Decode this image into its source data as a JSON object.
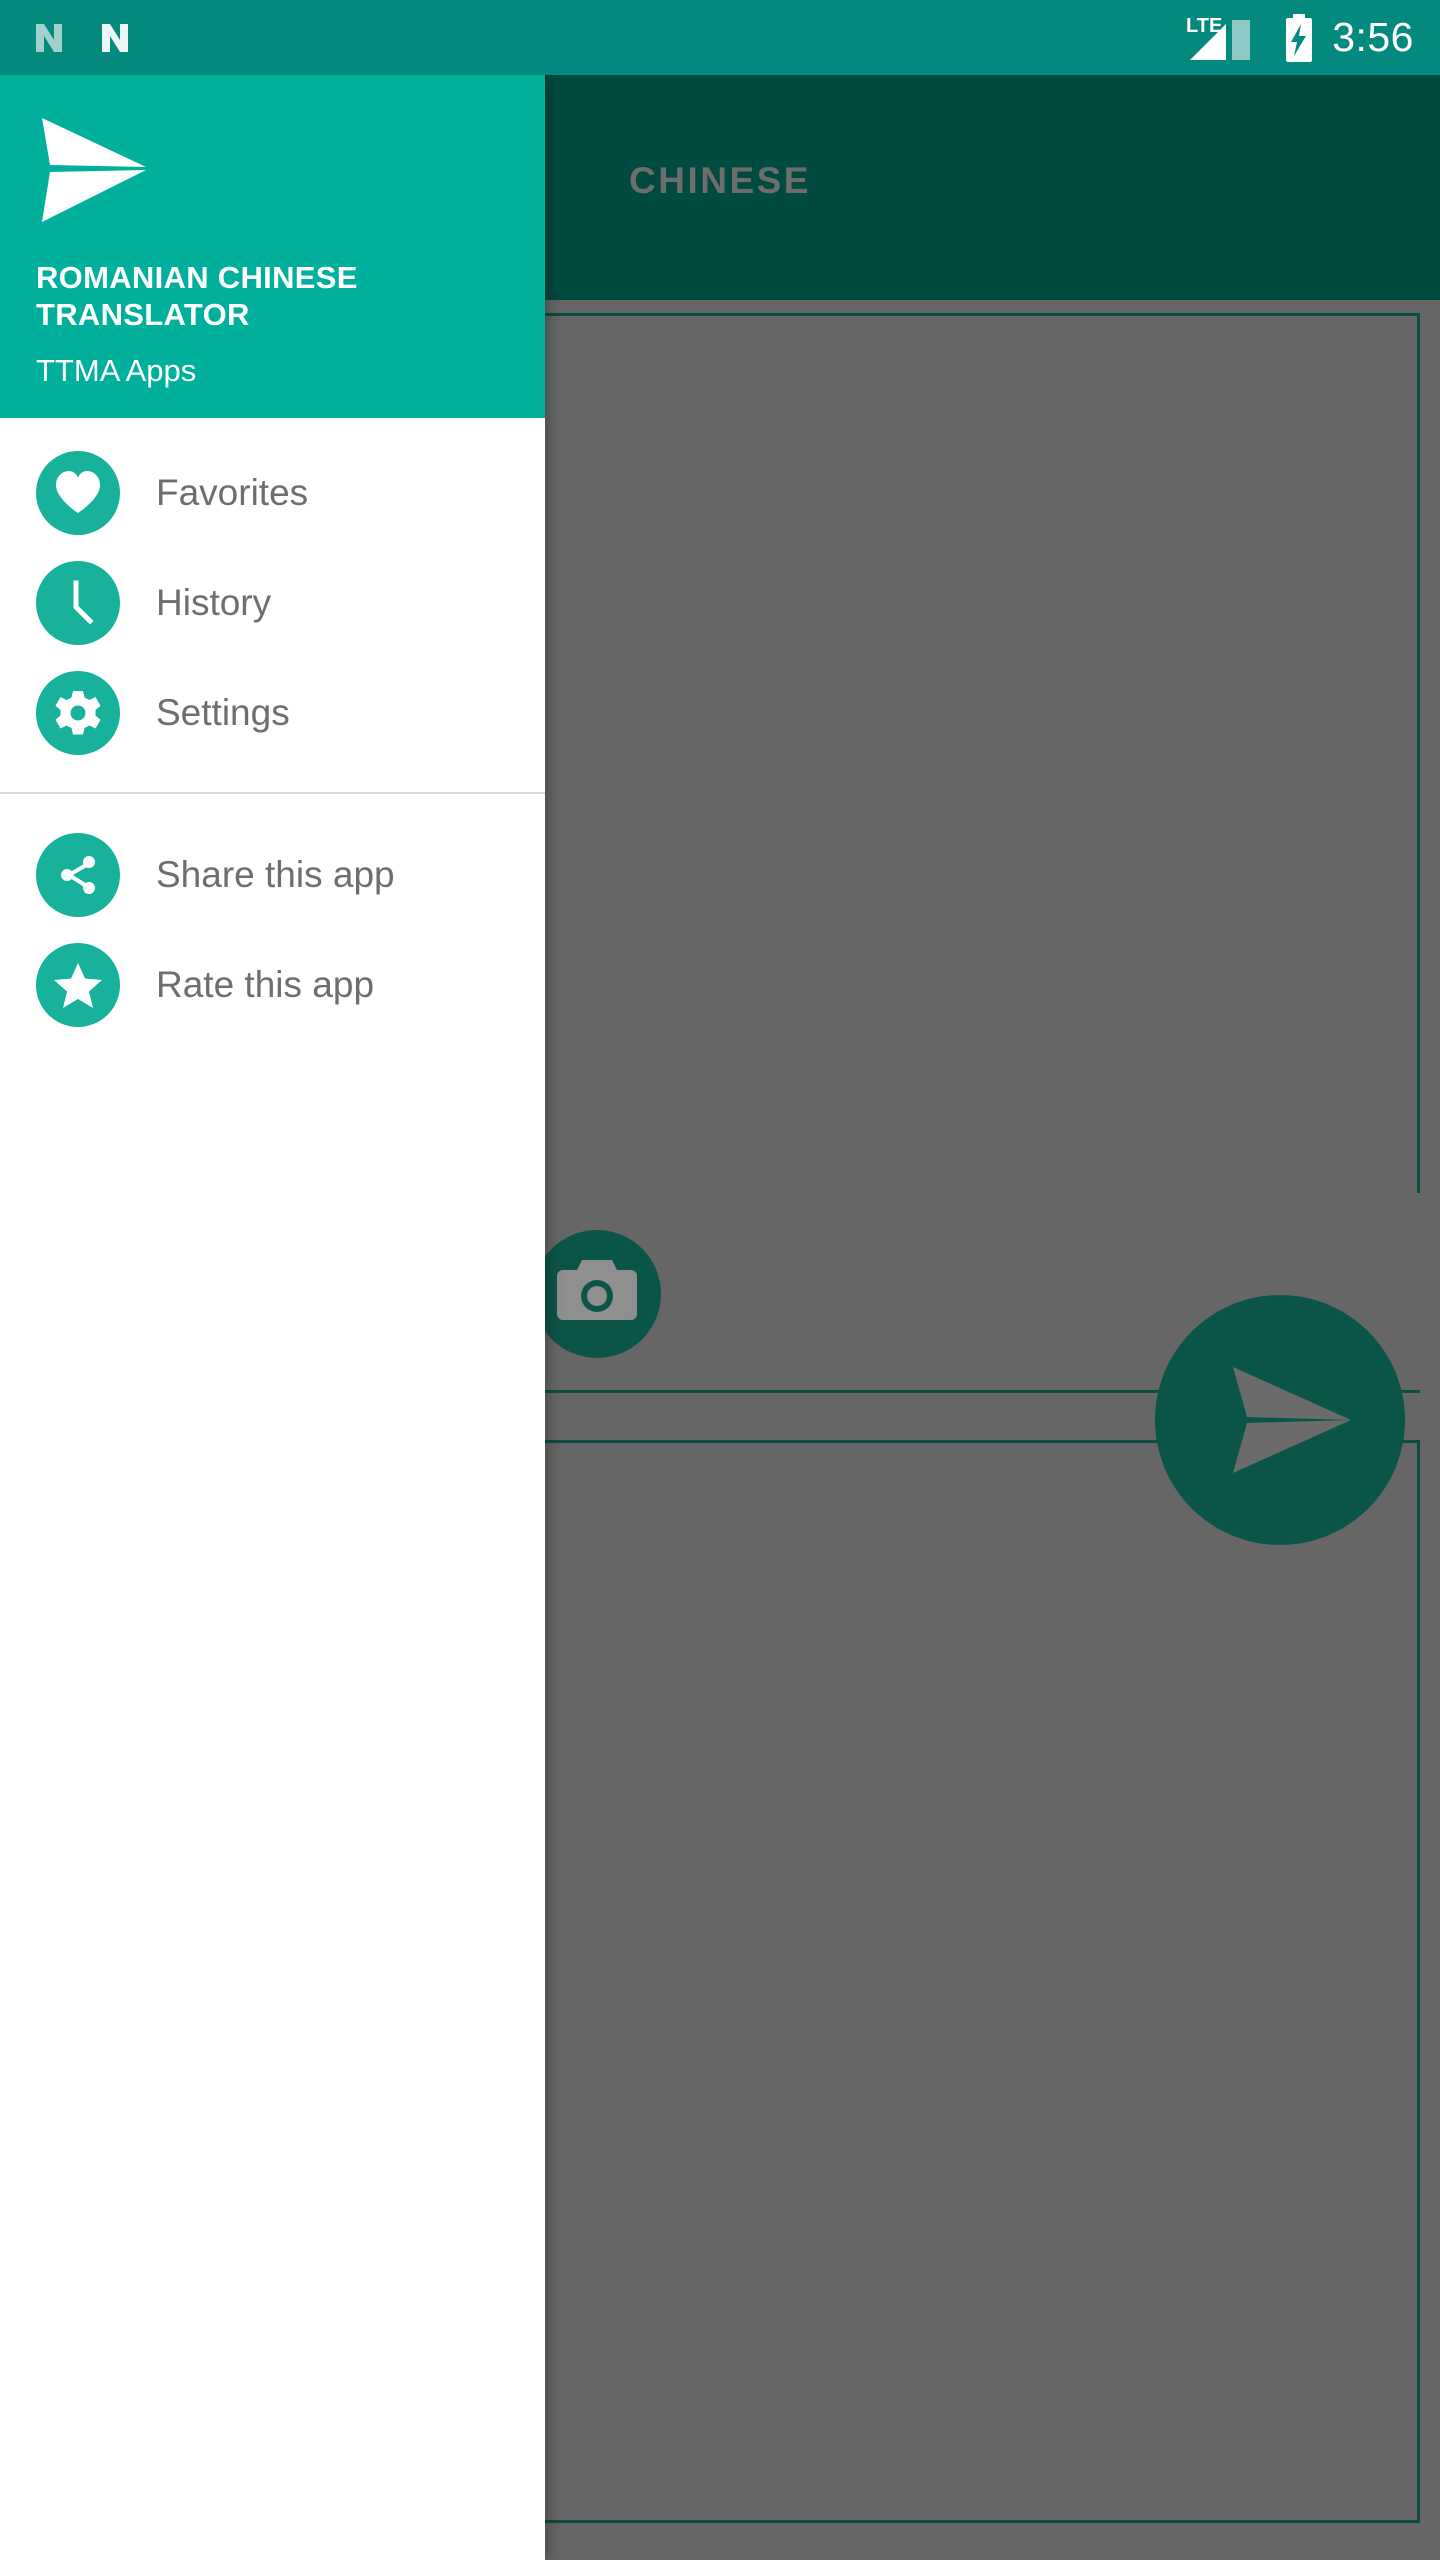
{
  "status_bar": {
    "left_icons": [
      "android-n-icon",
      "android-n-icon"
    ],
    "network_label": "LTE",
    "network_icon": "signal-bars-icon",
    "battery_icon": "battery-charging-icon",
    "clock": "3:56"
  },
  "drawer": {
    "logo_icon": "paper-plane-logo",
    "title": "ROMANIAN CHINESE TRANSLATOR",
    "subtitle": "TTMA Apps",
    "primary_items": [
      {
        "label": "Favorites",
        "icon": "heart-icon"
      },
      {
        "label": "History",
        "icon": "clock-icon"
      },
      {
        "label": "Settings",
        "icon": "gear-icon"
      }
    ],
    "secondary_items": [
      {
        "label": "Share this app",
        "icon": "share-icon"
      },
      {
        "label": "Rate this app",
        "icon": "star-icon"
      }
    ]
  },
  "background": {
    "tab_label": "CHINESE",
    "camera_button_icon": "camera-icon",
    "send_button_icon": "send-icon"
  },
  "colors": {
    "status_bar": "#03897E",
    "drawer_header": "#00B09C",
    "icon_circle": "#18B19B",
    "app_bar_dim": "#014A3F",
    "scrim": "#666666",
    "fab": "#0B5548",
    "label_text": "#6E6E6E",
    "tab_label_text": "#6D6D6D"
  }
}
